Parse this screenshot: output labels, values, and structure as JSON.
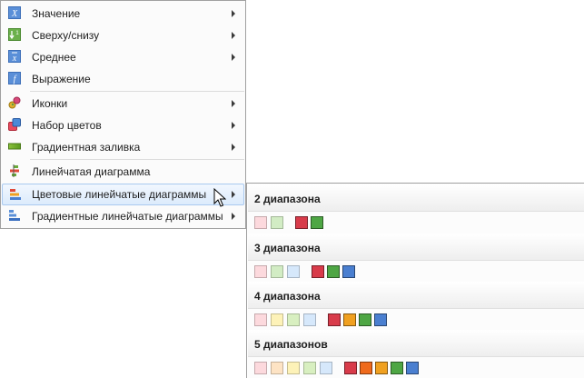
{
  "menu": {
    "items": [
      {
        "label": "Значение",
        "icon": "x-icon",
        "submenu": true
      },
      {
        "label": "Сверху/снизу",
        "icon": "top-bottom-icon",
        "submenu": true
      },
      {
        "label": "Среднее",
        "icon": "average-icon",
        "submenu": true
      },
      {
        "label": "Выражение",
        "icon": "function-icon",
        "submenu": false
      },
      {
        "label": "Иконки",
        "icon": "icons-icon",
        "submenu": true
      },
      {
        "label": "Набор цветов",
        "icon": "color-set-icon",
        "submenu": true
      },
      {
        "label": "Градиентная заливка",
        "icon": "gradient-fill-icon",
        "submenu": true
      },
      {
        "label": "Линейчатая диаграмма",
        "icon": "bar-chart-icon",
        "submenu": false
      },
      {
        "label": "Цветовые линейчатые диаграммы",
        "icon": "color-bar-chart-icon",
        "submenu": true,
        "highlighted": true
      },
      {
        "label": "Градиентные линейчатые диаграммы",
        "icon": "gradient-bar-chart-icon",
        "submenu": true
      }
    ]
  },
  "submenu": {
    "groups": [
      {
        "title": "2 диапазона",
        "light": [
          "#fcd9dd",
          "#d2ecc4"
        ],
        "dark": [
          "#d83b4a",
          "#4ea644"
        ]
      },
      {
        "title": "3 диапазона",
        "light": [
          "#fcd9dd",
          "#d2ecc4",
          "#d6e8fb"
        ],
        "dark": [
          "#d83b4a",
          "#4ea644",
          "#4a7fd0"
        ]
      },
      {
        "title": "4 диапазона",
        "light": [
          "#fcd9dd",
          "#fdf2b8",
          "#d8efc0",
          "#d6e8fb"
        ],
        "dark": [
          "#d83b4a",
          "#f0a020",
          "#4ea644",
          "#4a7fd0"
        ]
      },
      {
        "title": "5 диапазонов",
        "light": [
          "#fcd9dd",
          "#fde3c4",
          "#fdf2b8",
          "#d8efc0",
          "#d6e8fb"
        ],
        "dark": [
          "#d83b4a",
          "#ef6a1c",
          "#f0a020",
          "#4ea644",
          "#4a7fd0"
        ]
      }
    ]
  }
}
